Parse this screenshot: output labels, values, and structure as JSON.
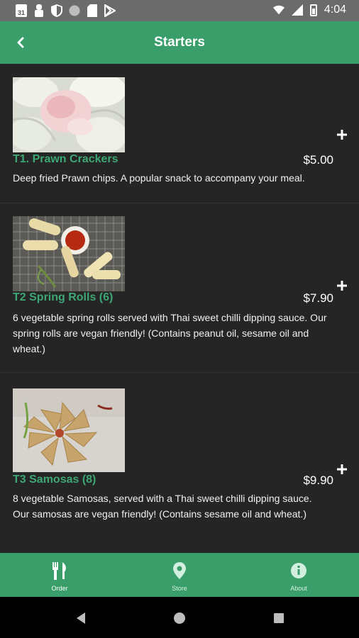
{
  "status_bar": {
    "calendar_day": "31",
    "time": "4:04",
    "left_icons": [
      "calendar-icon",
      "bug-icon",
      "shield-icon",
      "circle-icon",
      "sd-card-icon",
      "play-store-icon"
    ],
    "right_icons": [
      "wifi-icon",
      "signal-icon",
      "battery-icon"
    ]
  },
  "appbar": {
    "title": "Starters",
    "back_icon": "chevron-left-icon"
  },
  "items": [
    {
      "name": "T1. Prawn Crackers",
      "price": "$5.00",
      "description": "Deep fried Prawn chips. A popular snack to accompany your meal.",
      "add_icon": "plus-icon"
    },
    {
      "name": "T2 Spring Rolls (6)",
      "price": "$7.90",
      "description": "6 vegetable spring rolls served with Thai sweet chilli dipping sauce. Our spring rolls are vegan friendly! (Contains peanut oil, sesame oil and wheat.)",
      "add_icon": "plus-icon"
    },
    {
      "name": "T3 Samosas (8)",
      "price": "$9.90",
      "description": "8 vegetable Samosas, served with a Thai sweet chilli dipping sauce. Our samosas are vegan friendly! (Contains sesame oil and wheat.)",
      "add_icon": "plus-icon"
    }
  ],
  "bottom_nav": {
    "items": [
      {
        "label": "Order",
        "icon": "fork-knife-icon",
        "active": true
      },
      {
        "label": "Store",
        "icon": "location-pin-icon",
        "active": false
      },
      {
        "label": "About",
        "icon": "info-icon",
        "active": false
      }
    ]
  },
  "colors": {
    "brand_green": "#3a9e6a",
    "item_name_green": "#3ea774",
    "background": "#252525"
  }
}
